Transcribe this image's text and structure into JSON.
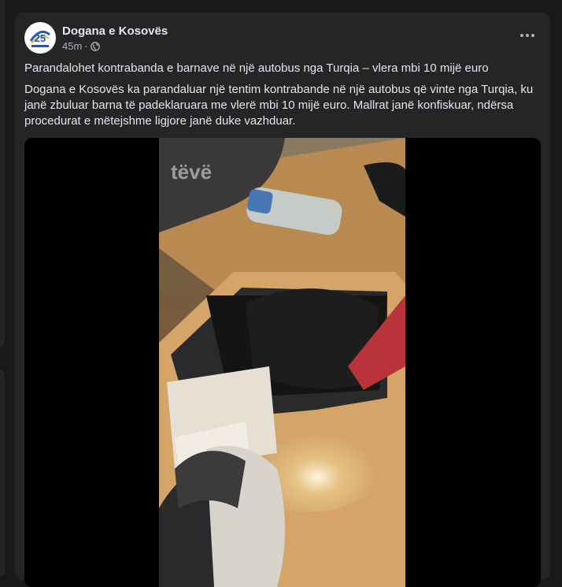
{
  "post": {
    "author": "Dogana e Kosovës",
    "time": "45m",
    "sep": "·",
    "visibility_icon": "globe-icon",
    "more_icon": "more-options-icon",
    "headline": "Parandalohet kontrabanda e barnave në një autobus nga Turqia – vlera mbi 10 mijë euro",
    "body": "Dogana e Kosovës ka parandaluar një tentim kontrabande në një autobus që vinte nga Turqia, ku janë zbuluar barna të padeklaruara me vlerë mbi 10 mijë euro. Mallrat janë konfiskuar, ndërsa procedurat e mëtejshme ligjore janë duke vazhduar.",
    "avatar_text": "25",
    "watermark": "tëvë"
  },
  "colors": {
    "background": "#18191a",
    "card": "#242526",
    "primary_text": "#e4e6eb",
    "secondary_text": "#b0b3b8"
  }
}
